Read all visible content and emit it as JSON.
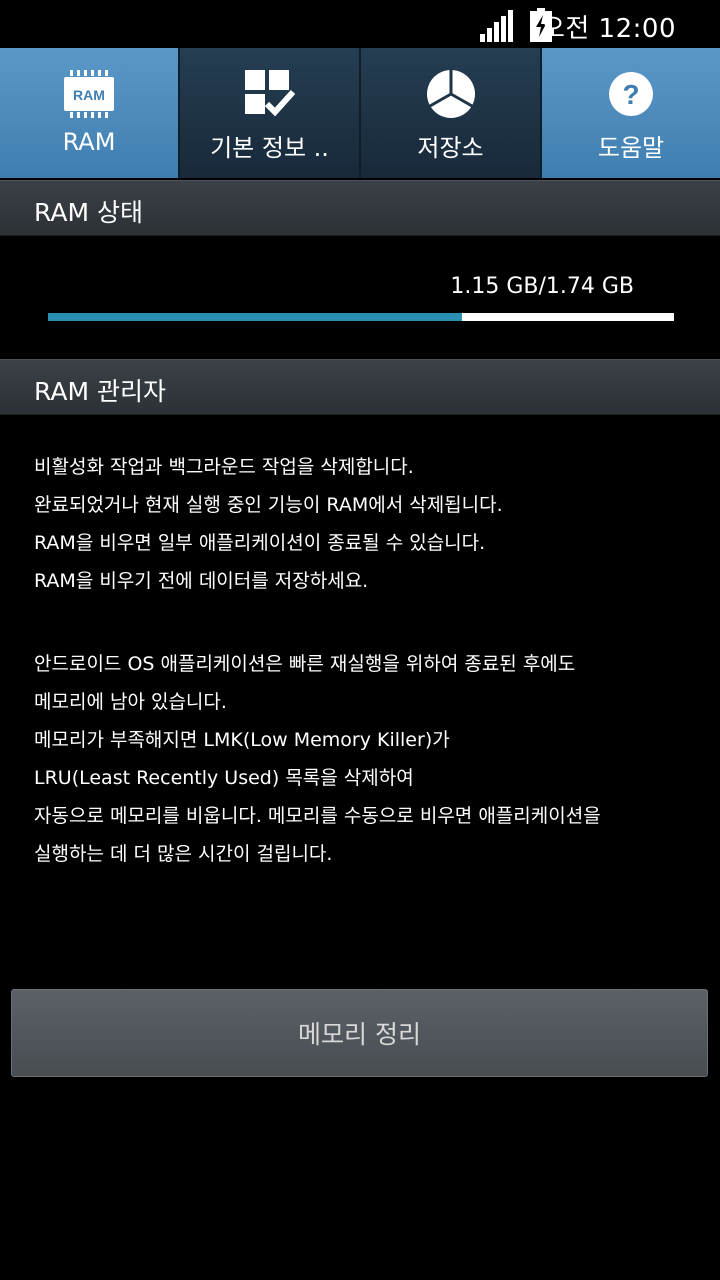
{
  "status_bar": {
    "time": "오전 12:00",
    "signal_icon": "signal-bars-icon",
    "battery_icon": "battery-charging-icon"
  },
  "tabs": [
    {
      "label": "RAM",
      "icon": "ram-chip-icon",
      "active": true
    },
    {
      "label": "기본 정보 ..",
      "icon": "info-checklist-icon",
      "active": false
    },
    {
      "label": "저장소",
      "icon": "storage-pie-icon",
      "active": false
    },
    {
      "label": "도움말",
      "icon": "help-icon",
      "active": true
    }
  ],
  "ram_status": {
    "title": "RAM 상태",
    "usage_text": "1.15 GB/1.74 GB",
    "used_fraction": 0.661,
    "bar_colors": {
      "used": "#2a8fb0",
      "free": "#ffffff"
    }
  },
  "ram_manager": {
    "title": "RAM 관리자",
    "paragraph1": [
      "비활성화 작업과 백그라운드 작업을 삭제합니다.",
      "완료되었거나 현재 실행 중인 기능이 RAM에서 삭제됩니다.",
      "RAM을 비우면 일부 애플리케이션이 종료될 수 있습니다.",
      "RAM을 비우기 전에 데이터를 저장하세요."
    ],
    "paragraph2": [
      "안드로이드 OS 애플리케이션은 빠른 재실행을 위하여 종료된 후에도",
      "메모리에 남아 있습니다.",
      "메모리가 부족해지면 LMK(Low Memory Killer)가",
      "LRU(Least Recently Used) 목록을 삭제하여",
      "자동으로 메모리를 비웁니다. 메모리를 수동으로 비우면 애플리케이션을",
      "실행하는 데 더 많은 시간이 걸립니다."
    ]
  },
  "clean_button_label": "메모리 정리"
}
